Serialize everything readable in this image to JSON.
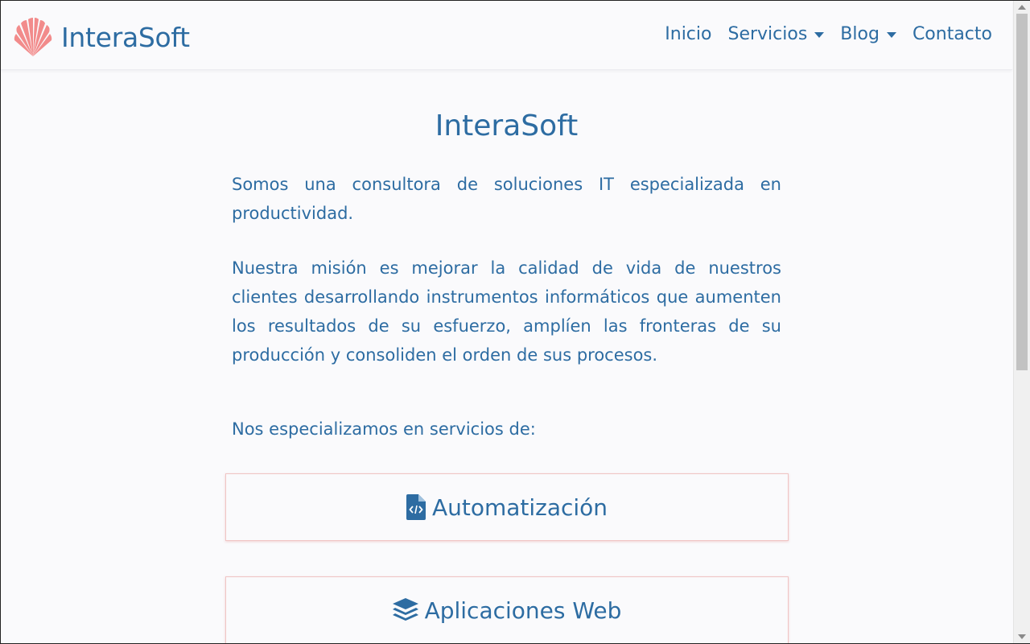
{
  "brand": {
    "name": "InteraSoft",
    "logo_icon": "shell-fan-logo",
    "logo_color": "#f28b8b"
  },
  "nav": {
    "items": [
      {
        "label": "Inicio",
        "dropdown": false
      },
      {
        "label": "Servicios",
        "dropdown": true
      },
      {
        "label": "Blog",
        "dropdown": true
      },
      {
        "label": "Contacto",
        "dropdown": false
      }
    ]
  },
  "main": {
    "title": "InteraSoft",
    "paragraphs": [
      "Somos una consultora de soluciones IT especializada en productividad.",
      "Nuestra misión es mejorar la calidad de vida de nuestros clientes desarrollando instrumentos informáticos que aumenten los resultados de su esfuerzo, amplíen las fronteras de su producción y consoliden el orden de sus procesos.",
      "Nos especializamos en servicios de:"
    ],
    "services": [
      {
        "label": "Automatización",
        "icon": "file-code-icon"
      },
      {
        "label": "Aplicaciones Web",
        "icon": "layers-icon"
      }
    ]
  },
  "colors": {
    "text": "#2d6ca2",
    "accent": "#f28b8b",
    "background": "#fafafc"
  }
}
